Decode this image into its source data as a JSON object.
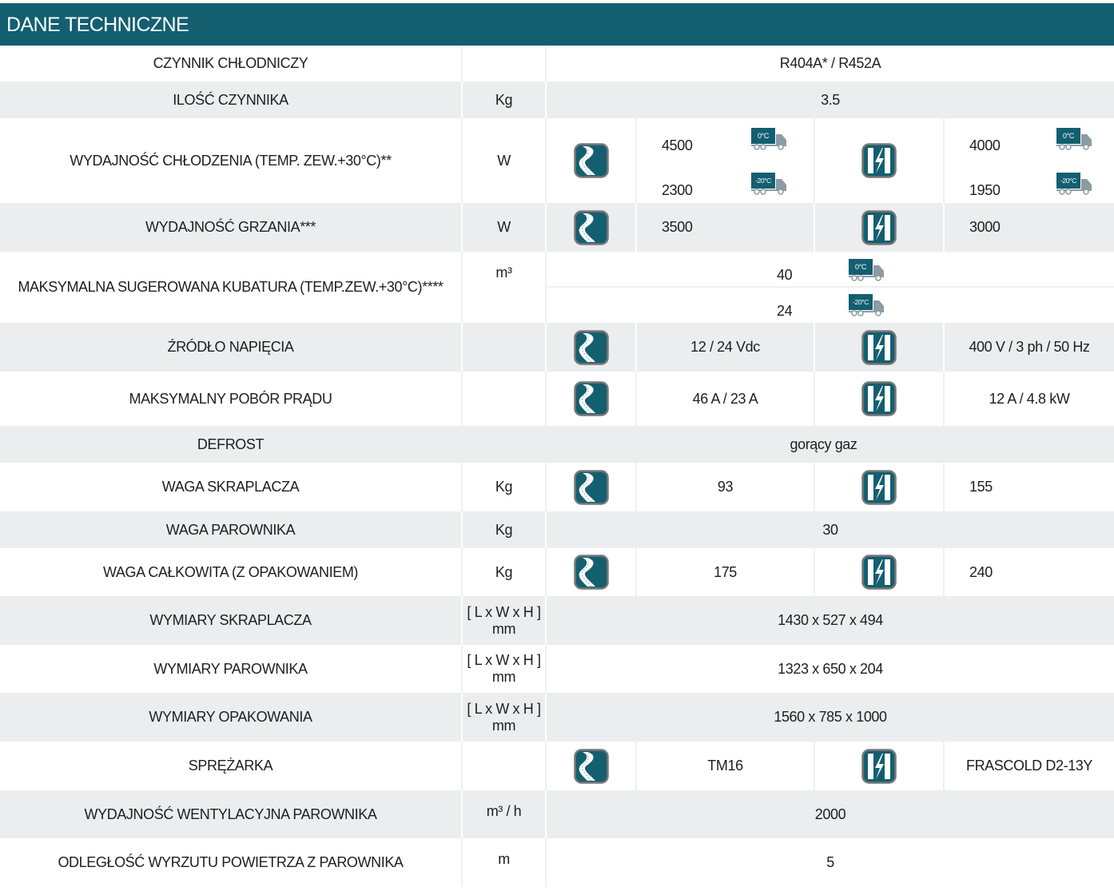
{
  "header": {
    "title": "DANE TECHNICZNE"
  },
  "colors": {
    "brand": "#135f70",
    "row_alt": "#ebedee"
  },
  "icons": {
    "variant1": "road-icon",
    "variant2": "lightning-icon",
    "truck": "truck-icon"
  },
  "trucks": {
    "t0": "0°C",
    "t20": "-20°C"
  },
  "rows": [
    {
      "type": "span",
      "label": "CZYNNIK CHŁODNICZY",
      "unit": "",
      "value": "R404A* / R452A"
    },
    {
      "type": "span",
      "label": "ILOŚĆ CZYNNIKA",
      "unit": "Kg",
      "value": "3.5"
    },
    {
      "type": "trucks",
      "label": "WYDAJNOŚĆ CHŁODZENIA (TEMP. ZEW.+30°C)**",
      "unit": "W",
      "v1": [
        "4500",
        "2300"
      ],
      "v2": [
        "4000",
        "1950"
      ]
    },
    {
      "type": "dual",
      "label": "WYDAJNOŚĆ GRZANIA***",
      "unit": "W",
      "v1": "3500",
      "v2": "3000"
    },
    {
      "type": "kub",
      "label": "MAKSYMALNA SUGEROWANA KUBATURA (TEMP.ZEW.+30°C)****",
      "unit": "m³",
      "values": [
        "40",
        "24"
      ]
    },
    {
      "type": "dual",
      "label": "ŹRÓDŁO NAPIĘCIA",
      "unit": "",
      "v1": "12 / 24 Vdc",
      "v2": "400 V / 3 ph / 50 Hz"
    },
    {
      "type": "dual",
      "label": "MAKSYMALNY POBÓR PRĄDU",
      "unit": "",
      "v1": "46 A / 23 A",
      "v2": "12 A / 4.8 kW"
    },
    {
      "type": "span2",
      "label": "DEFROST",
      "unit": "",
      "value": "gorący gaz"
    },
    {
      "type": "dual",
      "label": "WAGA SKRAPLACZA",
      "unit": "Kg",
      "v1": "93",
      "v2": "155"
    },
    {
      "type": "span",
      "label": "WAGA PAROWNIKA",
      "unit": "Kg",
      "value": "30"
    },
    {
      "type": "dual",
      "label": "WAGA CAŁKOWITA (Z OPAKOWANIEM)",
      "unit": "Kg",
      "v1": "175",
      "v2": "240"
    },
    {
      "type": "span",
      "label": "WYMIARY SKRAPLACZA",
      "unit": "[ L x W x H ]",
      "unit2": "mm",
      "value": "1430 x 527 x 494"
    },
    {
      "type": "span",
      "label": "WYMIARY PAROWNIKA",
      "unit": "[ L x W x H ]",
      "unit2": "mm",
      "value": "1323 x 650 x 204"
    },
    {
      "type": "span",
      "label": "WYMIARY OPAKOWANIA",
      "unit": "[ L x W x H ]",
      "unit2": "mm",
      "value": "1560 x 785 x 1000"
    },
    {
      "type": "dual",
      "label": "SPRĘŻARKA",
      "unit": "",
      "v1": "TM16",
      "v2": "FRASCOLD D2-13Y"
    },
    {
      "type": "span",
      "label": "WYDAJNOŚĆ WENTYLACYJNA PAROWNIKA",
      "unit": "m³ / h",
      "value": "2000"
    },
    {
      "type": "span",
      "label": "ODLEGŁOŚĆ WYRZUTU POWIETRZA Z PAROWNIKA",
      "unit": "m",
      "value": "5"
    }
  ]
}
